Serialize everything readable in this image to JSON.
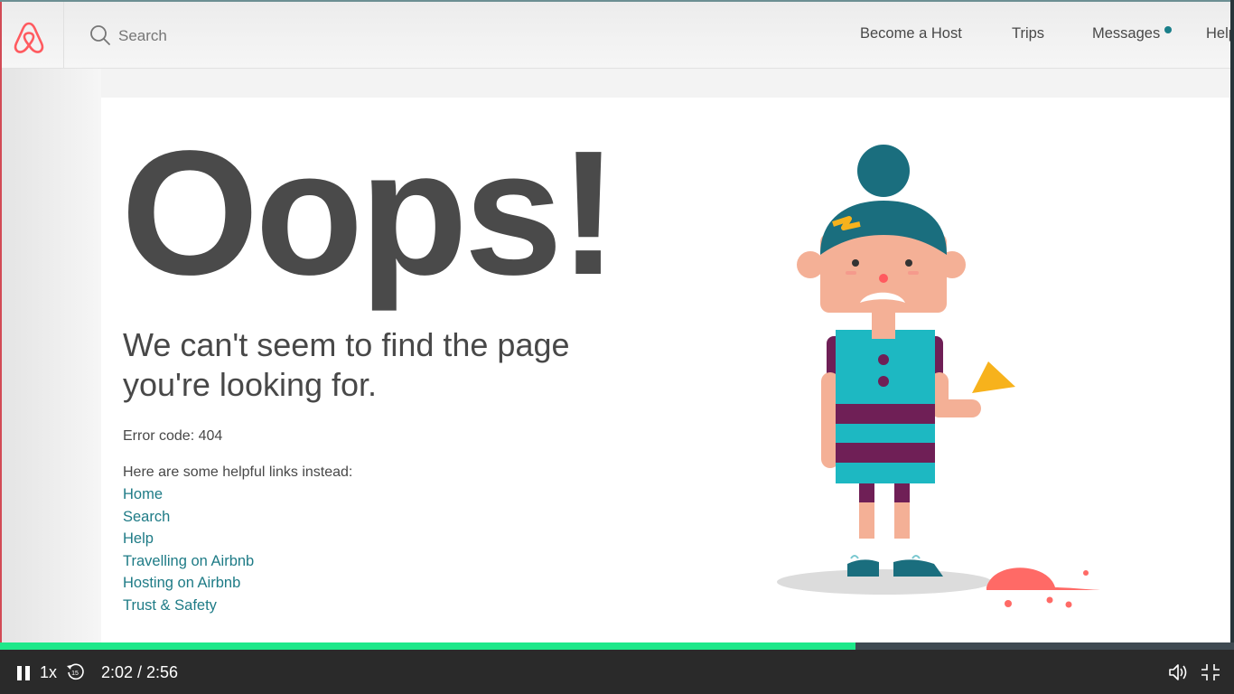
{
  "site": {
    "search_placeholder": "Search",
    "nav": [
      "Become a Host",
      "Trips",
      "Messages",
      "Help"
    ]
  },
  "page": {
    "heading": "Oops!",
    "subtitle": "We can't seem to find the page you're looking for.",
    "error_code": "Error code: 404",
    "helpful_links_intro": "Here are some helpful links instead:",
    "links": [
      "Home",
      "Search",
      "Help",
      "Travelling on Airbnb",
      "Hosting on Airbnb",
      "Trust & Safety"
    ]
  },
  "player": {
    "speed": "1x",
    "time": "2:02 / 2:56",
    "progress_fraction": 0.693,
    "accent_color": "#1ee88a"
  },
  "colors": {
    "brand": "#ff5a5f",
    "link": "#1e7b86",
    "heading": "#4a4a4a"
  },
  "icons": {
    "logo": "airbnb-logo",
    "search": "search-icon",
    "pause": "pause-icon",
    "rewind": "rewind-15-icon",
    "volume": "volume-icon",
    "exit_fullscreen": "exit-fullscreen-icon"
  }
}
